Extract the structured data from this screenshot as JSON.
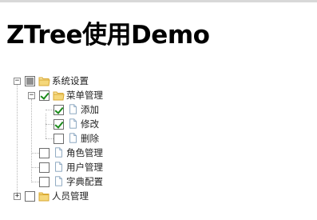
{
  "page": {
    "title": "ZTree使用Demo"
  },
  "tree": {
    "root": {
      "label": "系统设置",
      "switch": "−",
      "check": "partial",
      "icon": "folder-open-icon"
    },
    "menu": {
      "label": "菜单管理",
      "switch": "−",
      "check": "checked",
      "icon": "folder-open-icon"
    },
    "add": {
      "label": "添加",
      "check": "checked",
      "icon": "document-icon"
    },
    "edit": {
      "label": "修改",
      "check": "checked",
      "icon": "document-icon"
    },
    "delete": {
      "label": "删除",
      "check": "unchecked",
      "icon": "document-icon"
    },
    "role": {
      "label": "角色管理",
      "check": "unchecked",
      "icon": "document-icon"
    },
    "user": {
      "label": "用户管理",
      "check": "unchecked",
      "icon": "document-icon"
    },
    "dict": {
      "label": "字典配置",
      "check": "unchecked",
      "icon": "document-icon"
    },
    "people": {
      "label": "人员管理",
      "switch": "+",
      "check": "unchecked",
      "icon": "folder-closed-icon"
    }
  },
  "colors": {
    "folder": "#f5d77a",
    "folder_border": "#d9a933",
    "doc_border": "#7f9db9",
    "check_mark": "#1a8a1a"
  }
}
